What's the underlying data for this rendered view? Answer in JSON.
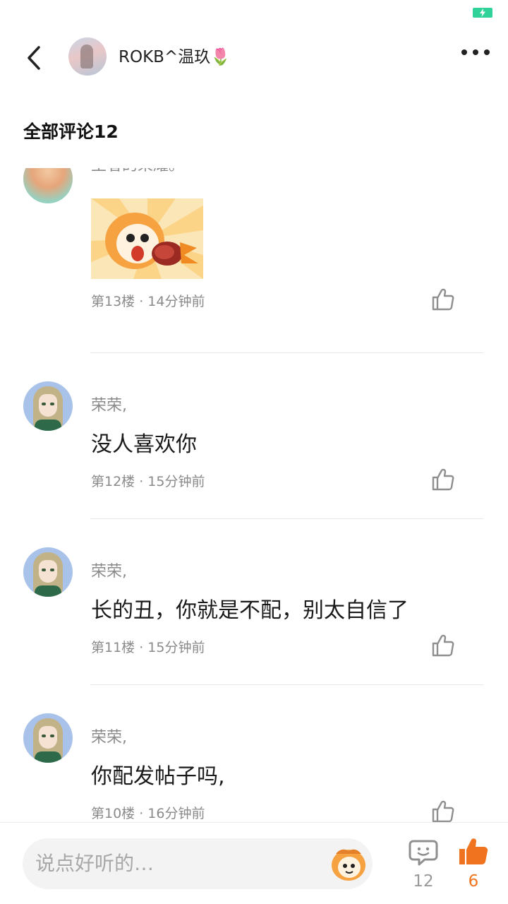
{
  "header": {
    "username": "ROKB^温玖🌷"
  },
  "section": {
    "title": "全部评论12"
  },
  "comments": [
    {
      "author": "王者的荣耀。",
      "floor_time": "第13楼 · 14分钟前",
      "has_sticker": true
    },
    {
      "author": "荣荣,",
      "text": "没人喜欢你",
      "floor_time": "第12楼 · 15分钟前"
    },
    {
      "author": "荣荣,",
      "text": "长的丑，你就是不配，别太自信了",
      "floor_time": "第11楼 · 15分钟前"
    },
    {
      "author": "荣荣,",
      "text": "你配发帖子吗,",
      "floor_time": "第10楼 · 16分钟前"
    }
  ],
  "bottom_bar": {
    "input_placeholder": "说点好听的…",
    "comment_count": "12",
    "like_count": "6"
  },
  "colors": {
    "accent_orange": "#f0741f",
    "battery_green": "#2fd39a",
    "muted_gray": "#8a8a8a"
  },
  "icons": [
    "battery-icon",
    "back-arrow-icon",
    "more-icon",
    "like-icon",
    "comment-icon",
    "emoji-icon"
  ]
}
